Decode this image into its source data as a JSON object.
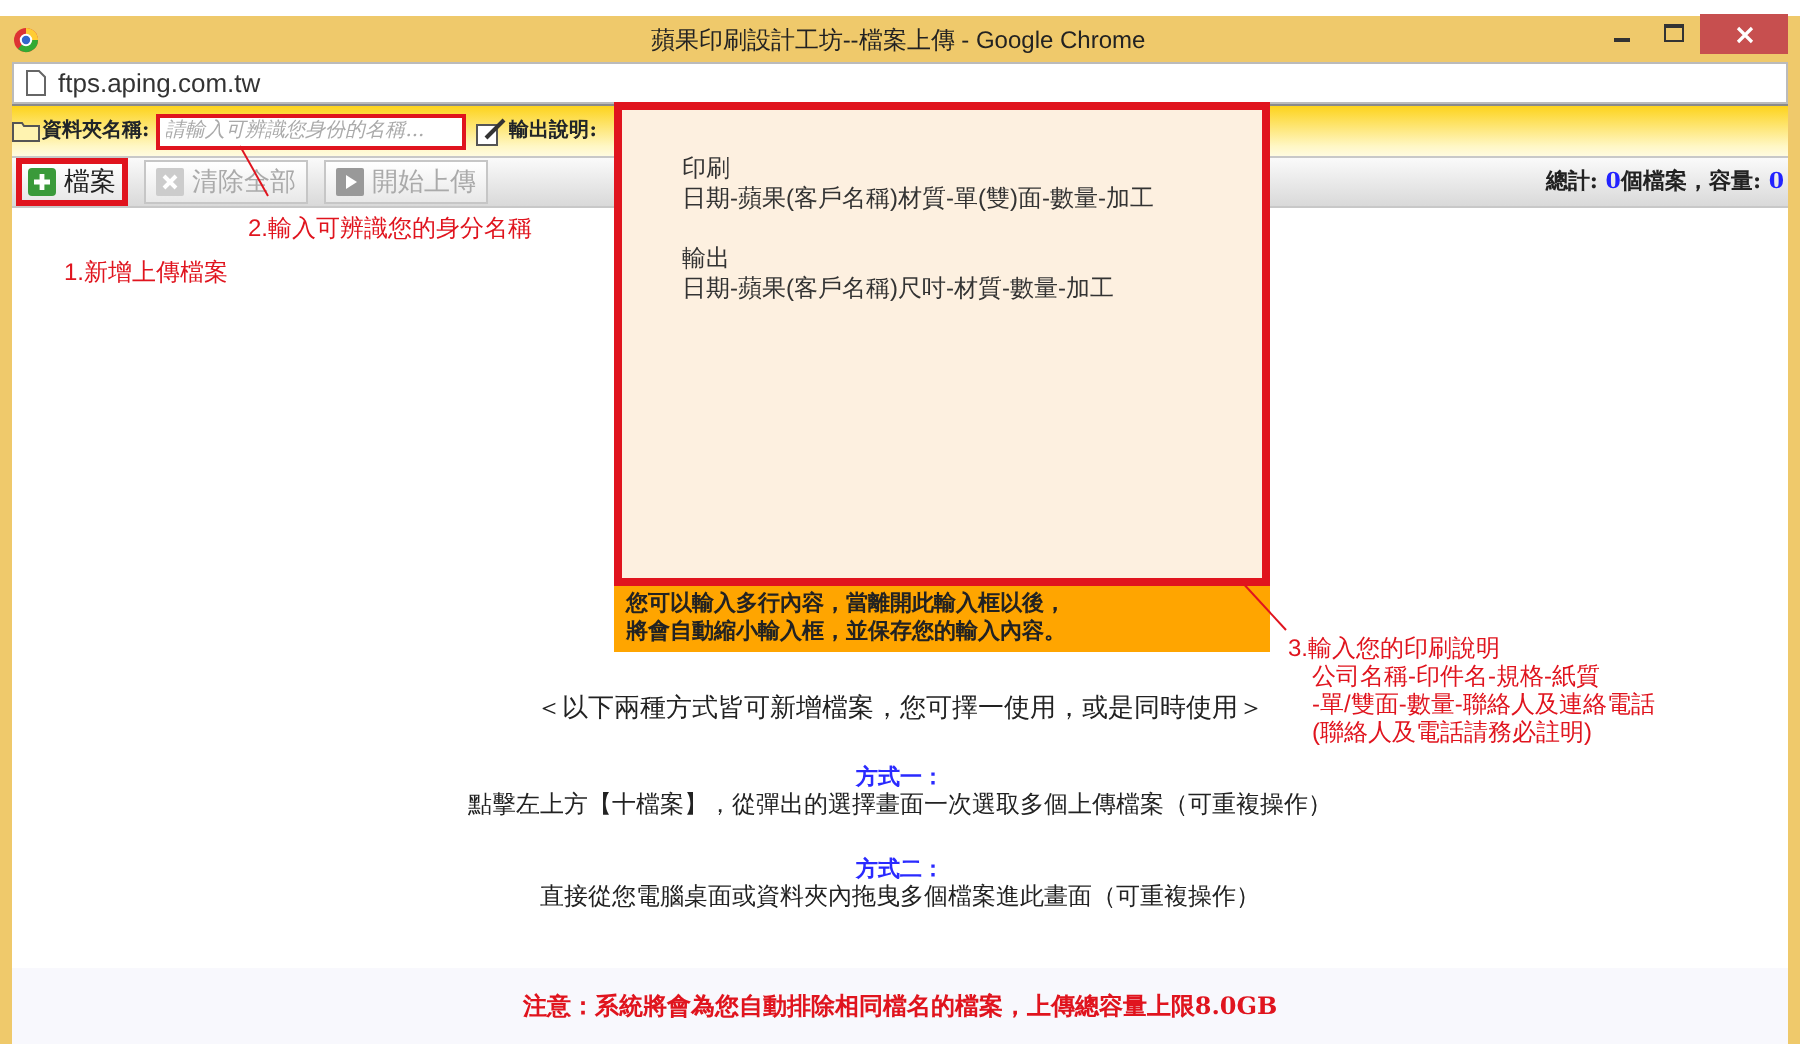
{
  "window": {
    "title": "蘋果印刷設計工坊--檔案上傳 - Google Chrome"
  },
  "address_bar": {
    "url": "ftps.aping.com.tw"
  },
  "toolbar": {
    "folder_label": "資料夾名稱:",
    "folder_placeholder": "請輸入可辨識您身份的名稱...",
    "output_label": "輸出說明:"
  },
  "buttons": [
    {
      "label": "檔案",
      "kind": "add",
      "disabled": false
    },
    {
      "label": "清除全部",
      "kind": "clear",
      "disabled": true
    },
    {
      "label": "開始上傳",
      "kind": "start",
      "disabled": true
    }
  ],
  "totals": {
    "files_label": "總計: ",
    "files": "0",
    "size_label": "個檔案，容量: ",
    "size": "0"
  },
  "description_popup": {
    "paragraphs": [
      [
        "印刷",
        "日期-蘋果(客戶名稱)材質-單(雙)面-數量-加工"
      ],
      [
        "輸出",
        "日期-蘋果(客戶名稱)尺吋-材質-數量-加工"
      ]
    ],
    "notes": [
      "您可以輸入多行內容，當離開此輸入框以後，",
      "將會自動縮小輸入框，並保存您的輸入內容。"
    ]
  },
  "annotations": [
    {
      "lines": [
        "2.輸入可辨識您的身分名稱"
      ]
    },
    {
      "lines": [
        "1.新增上傳檔案"
      ]
    },
    {
      "lines": [
        "3.輸入您的印刷說明",
        "公司名稱-印件名-規格-紙質",
        "-單/雙面-數量-聯絡人及連絡電話",
        "(聯絡人及電話請務必註明)"
      ]
    }
  ],
  "instructions": {
    "intro": "＜以下兩種方式皆可新增檔案，您可擇一使用，或是同時使用＞",
    "methods": [
      {
        "title": "方式一：",
        "text": "點擊左上方【十檔案】，從彈出的選擇畫面一次選取多個上傳檔案（可重複操作）"
      },
      {
        "title": "方式二：",
        "text": "直接從您電腦桌面或資料夾內拖曳多個檔案進此畫面（可重複操作）"
      }
    ]
  },
  "notice": "注意：系統將會為您自動排除相同檔名的檔案，上傳總容量上限8.0GB"
}
